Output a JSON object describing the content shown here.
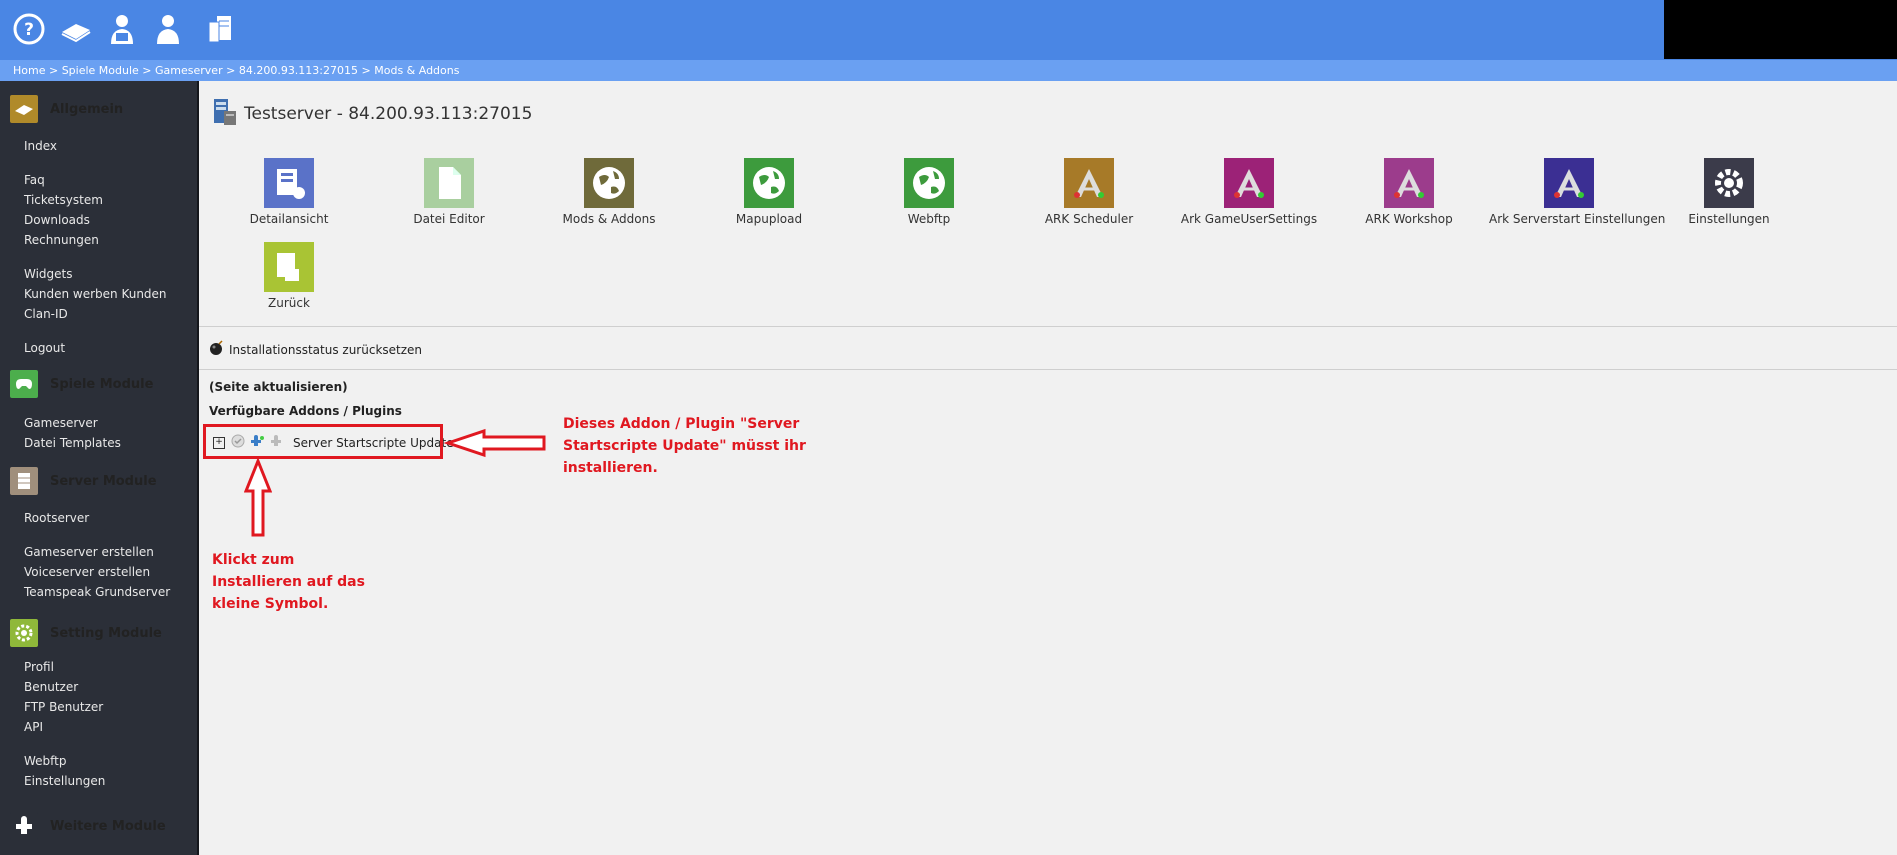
{
  "topbar": {
    "icons": [
      "help-icon",
      "book-icon",
      "admin-user-icon",
      "user-icon",
      "server-stack-icon"
    ]
  },
  "breadcrumb": [
    "Home",
    "Spiele Module",
    "Gameserver",
    "84.200.93.113:27015",
    "Mods & Addons"
  ],
  "breadcrumb_separator": " > ",
  "sidebar": {
    "sections": [
      {
        "title": "Allgemein",
        "color": "#b08a2a",
        "items": [
          "Index",
          "Faq",
          "Ticketsystem",
          "Downloads",
          "Rechnungen",
          "Widgets",
          "Kunden werben Kunden",
          "Clan-ID",
          "Logout"
        ]
      },
      {
        "title": "Spiele Module",
        "color": "#4cae4c",
        "items": [
          "Gameserver",
          "Datei Templates"
        ]
      },
      {
        "title": "Server Module",
        "color": "#a08f7c",
        "items": [
          "Rootserver",
          "Gameserver erstellen",
          "Voiceserver erstellen",
          "Teamspeak Grundserver"
        ]
      },
      {
        "title": "Setting Module",
        "color": "#8fb83a",
        "items": [
          "Profil",
          "Benutzer",
          "FTP Benutzer",
          "API",
          "Webftp",
          "Einstellungen"
        ]
      },
      {
        "title": "Weitere Module",
        "color": "#2b2f38",
        "items": []
      }
    ]
  },
  "main": {
    "server_title": "Testserver - 84.200.93.113:27015",
    "tiles": [
      {
        "label": "Detailansicht",
        "color": "#5a72c8"
      },
      {
        "label": "Datei Editor",
        "color": "#a9cf9f"
      },
      {
        "label": "Mods & Addons",
        "color": "#6f6a3a"
      },
      {
        "label": "Mapupload",
        "color": "#3d9b3d"
      },
      {
        "label": "Webftp",
        "color": "#3d9b3d"
      },
      {
        "label": "ARK Scheduler",
        "color": "#a77a28"
      },
      {
        "label": "Ark GameUserSettings",
        "color": "#9c2277"
      },
      {
        "label": "ARK Workshop",
        "color": "#9c3c8c"
      },
      {
        "label": "Ark Serverstart Einstellungen",
        "color": "#3b2f93"
      },
      {
        "label": "Einstellungen",
        "color": "#3b3b4a"
      },
      {
        "label": "Zurück",
        "color": "#a9c434"
      }
    ],
    "reset_label": "Installationsstatus zurücksetzen",
    "refresh_label": "(Seite aktualisieren)",
    "addons_heading": "Verfügbare Addons / Plugins",
    "addon": {
      "expander": "+",
      "name": "Server Startscripte Update"
    }
  },
  "annotations": {
    "right": [
      "Dieses Addon / Plugin \"Server",
      "Startscripte Update\" müsst ihr",
      "installieren."
    ],
    "bottom": [
      "Klickt zum",
      "Installieren auf das",
      "kleine Symbol."
    ],
    "color": "#e01820"
  }
}
